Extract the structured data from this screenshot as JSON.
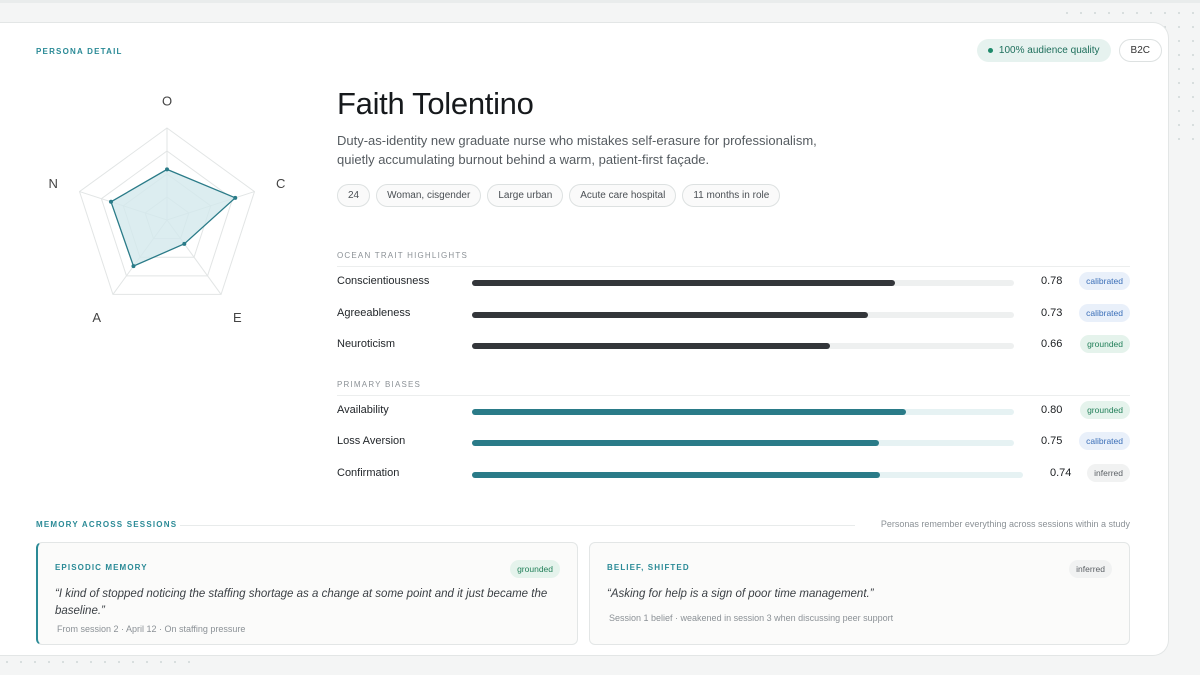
{
  "header": {
    "eyebrow": "PERSONA DETAIL",
    "quality_badge": "100% audience quality",
    "segment_badge": "B2C"
  },
  "radar": {
    "axes": [
      "O",
      "C",
      "E",
      "A",
      "N"
    ],
    "values": [
      0.55,
      0.78,
      0.32,
      0.62,
      0.64
    ],
    "colors": {
      "stroke": "#2a7b88",
      "fill": "#d3e9ec"
    }
  },
  "persona": {
    "name": "Faith Tolentino",
    "description": "Duty-as-identity new graduate nurse who mistakes self-erasure for professionalism, quietly accumulating burnout behind a warm, patient-first façade.",
    "tags": [
      "24",
      "Woman, cisgender",
      "Large urban",
      "Acute care hospital",
      "11 months in role"
    ]
  },
  "ocean": {
    "title": "OCEAN TRAIT HIGHLIGHTS",
    "rows": [
      {
        "label": "Conscientiousness",
        "value": "0.78",
        "status": "calibrated"
      },
      {
        "label": "Agreeableness",
        "value": "0.73",
        "status": "calibrated"
      },
      {
        "label": "Neuroticism",
        "value": "0.66",
        "status": "grounded"
      }
    ]
  },
  "biases": {
    "title": "PRIMARY BIASES",
    "rows": [
      {
        "label": "Availability",
        "value": "0.80",
        "status": "grounded"
      },
      {
        "label": "Loss Aversion",
        "value": "0.75",
        "status": "calibrated"
      },
      {
        "label": "Confirmation",
        "value": "0.74",
        "status": "inferred"
      }
    ]
  },
  "memory": {
    "title": "MEMORY ACROSS SESSIONS",
    "note": "Personas remember everything across sessions within a study",
    "episodic": {
      "title": "EPISODIC MEMORY",
      "status": "grounded",
      "quote": "“I kind of stopped noticing the staffing shortage as a change at some point and it just became the baseline.”",
      "footer": "From session 2 · April 12 · On staffing pressure"
    },
    "belief": {
      "title": "BELIEF, SHIFTED",
      "status": "inferred",
      "quote": "“Asking for help is a sign of poor time management.”",
      "footer": "Session 1 belief · weakened in session 3 when discussing peer support"
    }
  }
}
